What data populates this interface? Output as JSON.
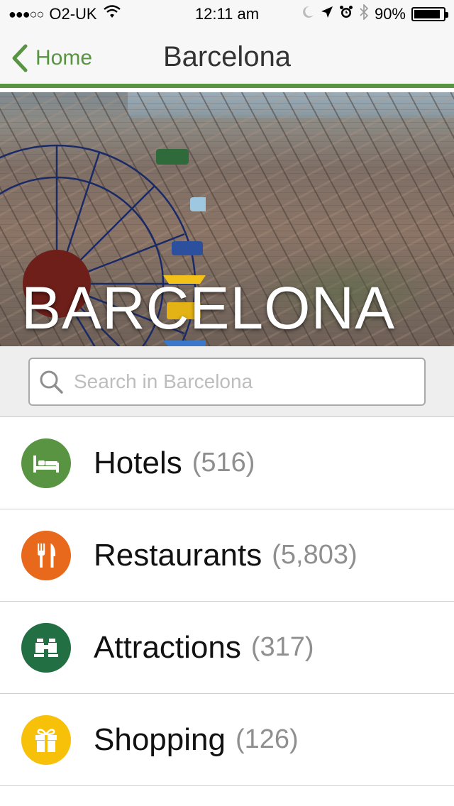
{
  "status": {
    "carrier": "O2-UK",
    "time": "12:11 am",
    "battery": "90%",
    "battery_level": 0.9
  },
  "nav": {
    "back_label": "Home",
    "title": "Barcelona"
  },
  "hero": {
    "title": "BARCELONA"
  },
  "search": {
    "placeholder": "Search in Barcelona",
    "value": ""
  },
  "categories": [
    {
      "label": "Hotels",
      "count": "(516)",
      "icon": "bed-icon",
      "color": "#589442"
    },
    {
      "label": "Restaurants",
      "count": "(5,803)",
      "icon": "fork-knife-icon",
      "color": "#e8691b"
    },
    {
      "label": "Attractions",
      "count": "(317)",
      "icon": "binoculars-icon",
      "color": "#216f43"
    },
    {
      "label": "Shopping",
      "count": "(126)",
      "icon": "gift-icon",
      "color": "#f7c10a"
    }
  ],
  "colors": {
    "accent": "#589442",
    "nav_background": "#f7f7f7"
  }
}
